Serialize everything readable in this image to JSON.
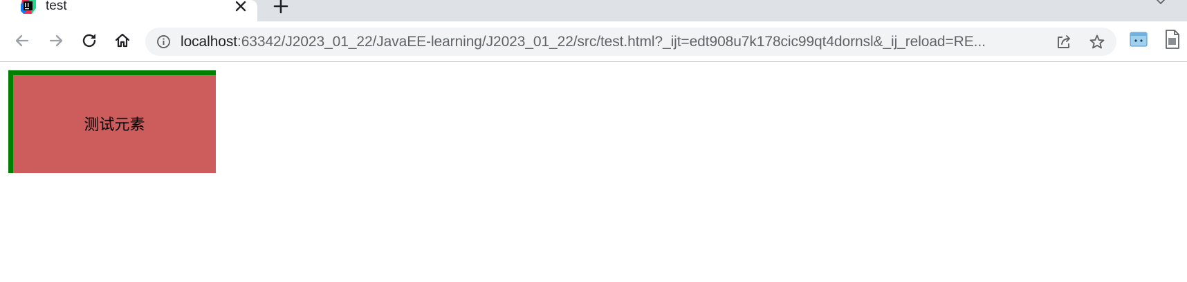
{
  "browser": {
    "tab": {
      "title": "test",
      "favicon": "intellij-idea-icon"
    },
    "toolbar": {
      "back": "back-arrow-icon",
      "forward": "forward-arrow-icon",
      "reload": "reload-icon",
      "home": "home-icon"
    },
    "address_bar": {
      "host": "localhost",
      "rest": ":63342/J2023_01_22/JavaEE-learning/J2023_01_22/src/test.html?_ijt=edt908u7k178cic99qt4dornsl&_ij_reload=RE..."
    }
  },
  "page": {
    "element_text": "测试元素"
  },
  "colors": {
    "tabstrip": "#dee1e6",
    "omnibox": "#f1f3f4",
    "element_background": "#cd5c5c",
    "element_border": "#008000"
  }
}
